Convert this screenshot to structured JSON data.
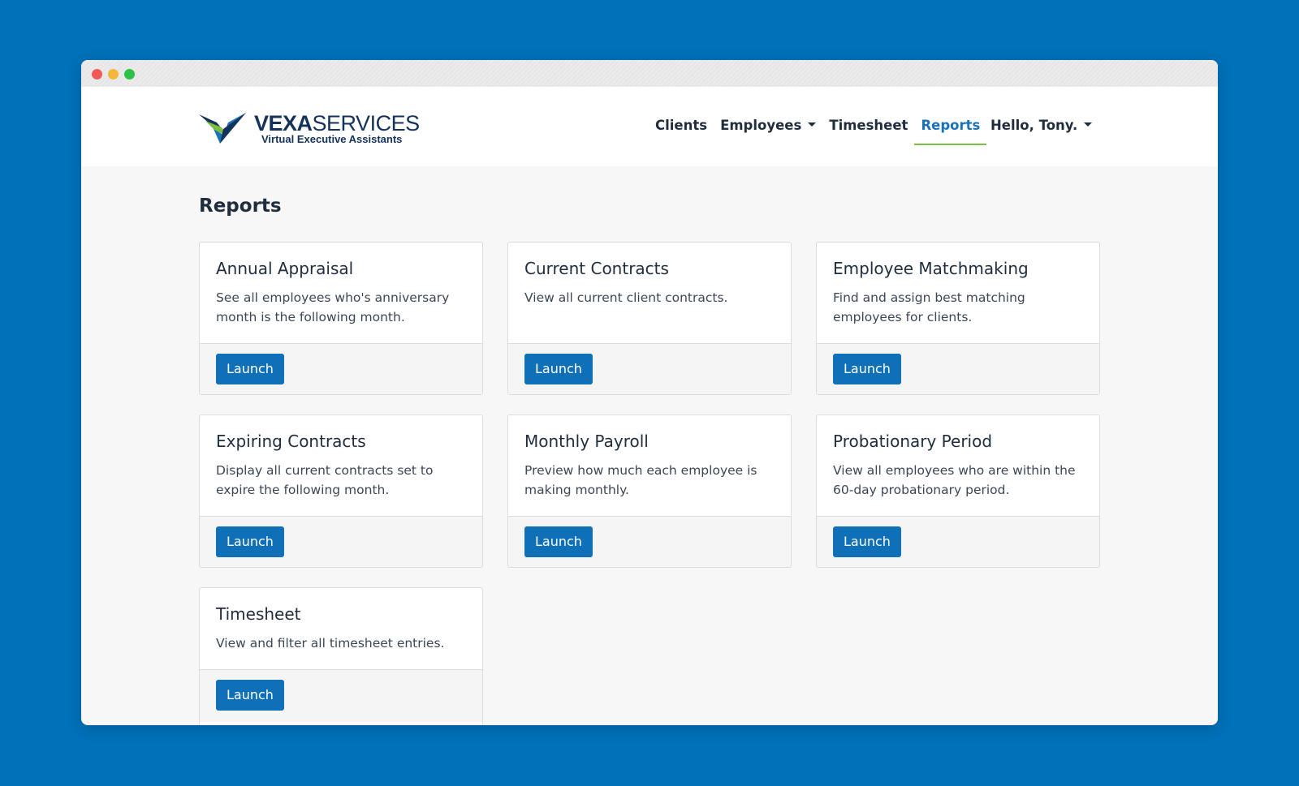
{
  "window": {
    "title_bar_buttons": [
      "close",
      "minimize",
      "maximize"
    ]
  },
  "brand": {
    "name_bold": "VEXA",
    "name_regular": "SERVICES",
    "tagline": "Virtual Executive Assistants",
    "colors": {
      "navy": "#15325b",
      "blue": "#0f70b7",
      "green": "#7cbf3e"
    }
  },
  "nav": {
    "items": [
      {
        "label": "Clients",
        "dropdown": false,
        "active": false
      },
      {
        "label": "Employees",
        "dropdown": true,
        "active": false
      },
      {
        "label": "Timesheet",
        "dropdown": false,
        "active": false
      },
      {
        "label": "Reports",
        "dropdown": false,
        "active": true
      }
    ],
    "user_greeting": "Hello, Tony."
  },
  "page": {
    "title": "Reports"
  },
  "reports": [
    {
      "title": "Annual Appraisal",
      "description": "See all employees who's anniversary month is the following month.",
      "button": "Launch"
    },
    {
      "title": "Current Contracts",
      "description": "View all current client contracts.",
      "button": "Launch"
    },
    {
      "title": "Employee Matchmaking",
      "description": "Find and assign best matching employees for clients.",
      "button": "Launch"
    },
    {
      "title": "Expiring Contracts",
      "description": "Display all current contracts set to expire the following month.",
      "button": "Launch"
    },
    {
      "title": "Monthly Payroll",
      "description": "Preview how much each employee is making monthly.",
      "button": "Launch"
    },
    {
      "title": "Probationary Period",
      "description": "View all employees who are within the 60-day probationary period.",
      "button": "Launch"
    },
    {
      "title": "Timesheet",
      "description": "View and filter all timesheet entries.",
      "button": "Launch"
    }
  ]
}
